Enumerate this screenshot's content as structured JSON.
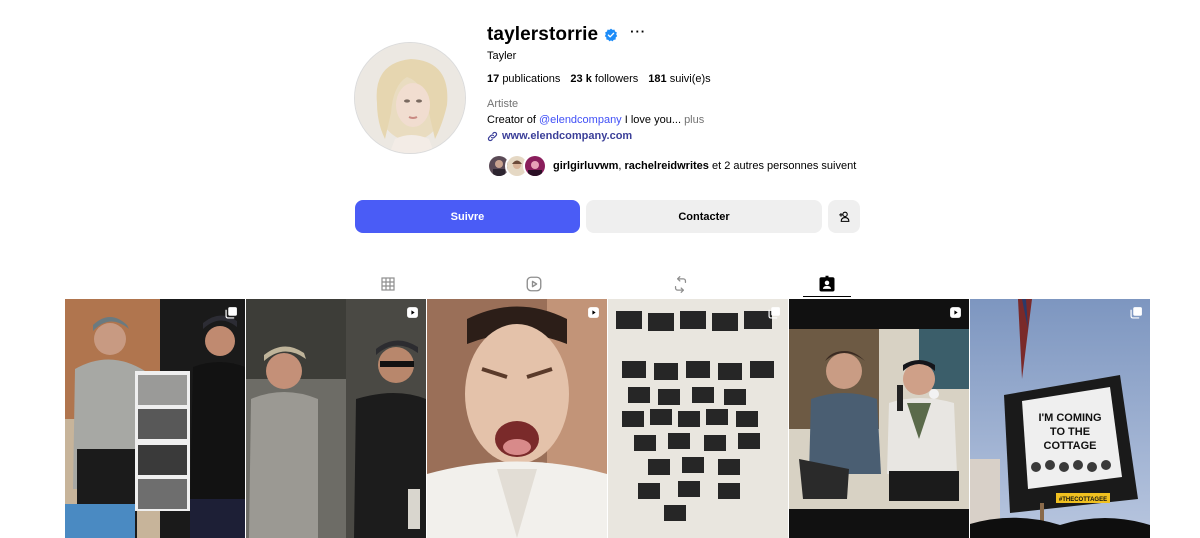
{
  "profile": {
    "username": "taylerstorrie",
    "full_name": "Tayler",
    "more_label": "···",
    "stats": {
      "posts_count": "17",
      "posts_label": "publications",
      "followers_count": "23 k",
      "followers_label": "followers",
      "following_count": "181",
      "following_label": "suivi(e)s"
    },
    "category": "Artiste",
    "bio_prefix": "Creator of ",
    "bio_mention": "@elendcompany",
    "bio_suffix": " I love you...",
    "bio_more": "plus",
    "website": "www.elendcompany.com",
    "followed_by": {
      "user1": "girlgirluvwm",
      "separator": ", ",
      "user2": "rachelreidwrites",
      "suffix": " et 2 autres personnes suivent"
    }
  },
  "actions": {
    "follow_label": "Suivre",
    "contact_label": "Contacter"
  },
  "tabs": [
    {
      "icon": "grid-icon",
      "active": false
    },
    {
      "icon": "reels-icon",
      "active": false
    },
    {
      "icon": "reposts-icon",
      "active": false
    },
    {
      "icon": "tagged-icon",
      "active": true
    }
  ],
  "posts": [
    {
      "type": "carousel",
      "badge": "carousel-icon"
    },
    {
      "type": "reel",
      "badge": "reel-icon"
    },
    {
      "type": "reel",
      "badge": "reel-icon"
    },
    {
      "type": "carousel",
      "badge": "carousel-icon"
    },
    {
      "type": "reel",
      "badge": "reel-icon"
    },
    {
      "type": "carousel",
      "badge": "carousel-icon",
      "sign_line1": "I'M COMING",
      "sign_line2": "TO THE",
      "sign_line3": "COTTAGE",
      "sign_tag": "#THECOTTAGEE"
    }
  ],
  "colors": {
    "accent": "#4a5cf6",
    "verified": "#1d8cf8",
    "link": "#3b3f99",
    "mention": "#4150f7",
    "secondary_text": "#737373",
    "button_gray": "#efefef"
  }
}
